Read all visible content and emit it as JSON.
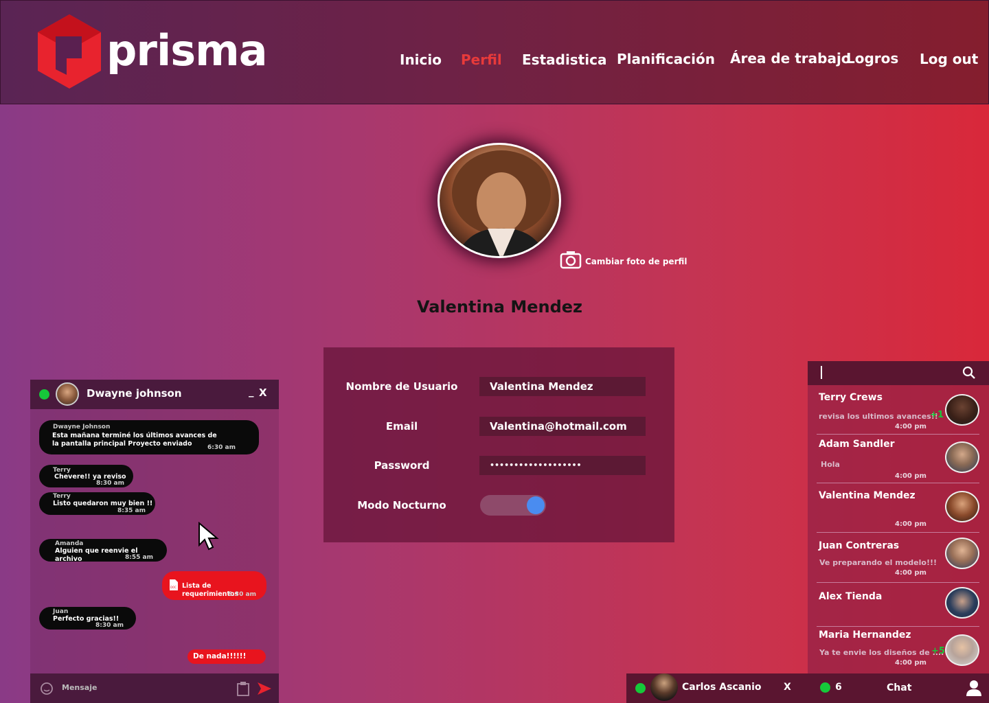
{
  "brand": {
    "name": "prisma",
    "accent": "#e8232e"
  },
  "nav": {
    "items": [
      {
        "label": "Inicio",
        "active": false
      },
      {
        "label": "Perfil",
        "active": true
      },
      {
        "label": "Estadistica",
        "active": false
      },
      {
        "label": "Planificación",
        "active": false
      },
      {
        "label": "Área de trabajo",
        "active": false
      },
      {
        "label": "Logros",
        "active": false
      },
      {
        "label": "Log out",
        "active": false
      }
    ]
  },
  "profile": {
    "change_photo_label": "Cambiar foto de perfil",
    "name": "Valentina Mendez",
    "fields": [
      {
        "label": "Nombre de Usuario",
        "value": "Valentina Mendez"
      },
      {
        "label": "Email",
        "value": "Valentina@hotmail.com"
      },
      {
        "label": "Password",
        "value": "•••••••••••••••••••"
      }
    ],
    "night_mode": {
      "label": "Modo Nocturno",
      "enabled": true
    }
  },
  "chat": {
    "contact_name": "Dwayne johnson",
    "minimize_label": "_",
    "close_label": "X",
    "messages": [
      {
        "sender": "Dwayne Johnson",
        "text": "Esta mañana terminé los últimos avances de la pantalla principal Proyecto enviado",
        "time": "6:30 am",
        "own": false
      },
      {
        "sender": "Terry",
        "text": "Chevere!! ya reviso",
        "time": "8:30 am",
        "own": false
      },
      {
        "sender": "Terry",
        "text": "Listo quedaron muy bien !!",
        "time": "8:35 am",
        "own": false
      },
      {
        "sender": "Amanda",
        "text": "Alguien que reenvie el archivo",
        "time": "8:55 am",
        "own": false
      },
      {
        "sender": "",
        "text": "Lista de requerimientos",
        "time": "8:30 am",
        "own": true,
        "attachment": "doc-file-icon"
      },
      {
        "sender": "Juan",
        "text": "Perfecto gracias!!",
        "time": "8:30 am",
        "own": false
      },
      {
        "sender": "",
        "text": "De nada!!!!!!",
        "time": "",
        "own": true
      }
    ],
    "input_placeholder": "Mensaje"
  },
  "contacts": {
    "search_icon": "search-icon",
    "items": [
      {
        "name": "Terry Crews",
        "message": "revisa los ultimos avances!!",
        "unread": "+1",
        "time": "4:00 pm"
      },
      {
        "name": "Adam Sandler",
        "message": "Hola",
        "unread": "",
        "time": "4:00 pm"
      },
      {
        "name": "Valentina Mendez",
        "message": "",
        "unread": "",
        "time": "4:00 pm"
      },
      {
        "name": "Juan Contreras",
        "message": "Ve preparando el modelo!!!",
        "unread": "",
        "time": "4:00 pm"
      },
      {
        "name": "Alex Tienda",
        "message": "",
        "unread": "",
        "time": ""
      },
      {
        "name": "Maria Hernandez",
        "message": "Ya te envie los diseños de ....",
        "unread": "+5",
        "time": "4:00 pm"
      }
    ]
  },
  "open_chat_tab": {
    "name": "Carlos Ascanio",
    "close_label": "X"
  },
  "status_bar": {
    "online_count": "6",
    "label": "Chat"
  }
}
